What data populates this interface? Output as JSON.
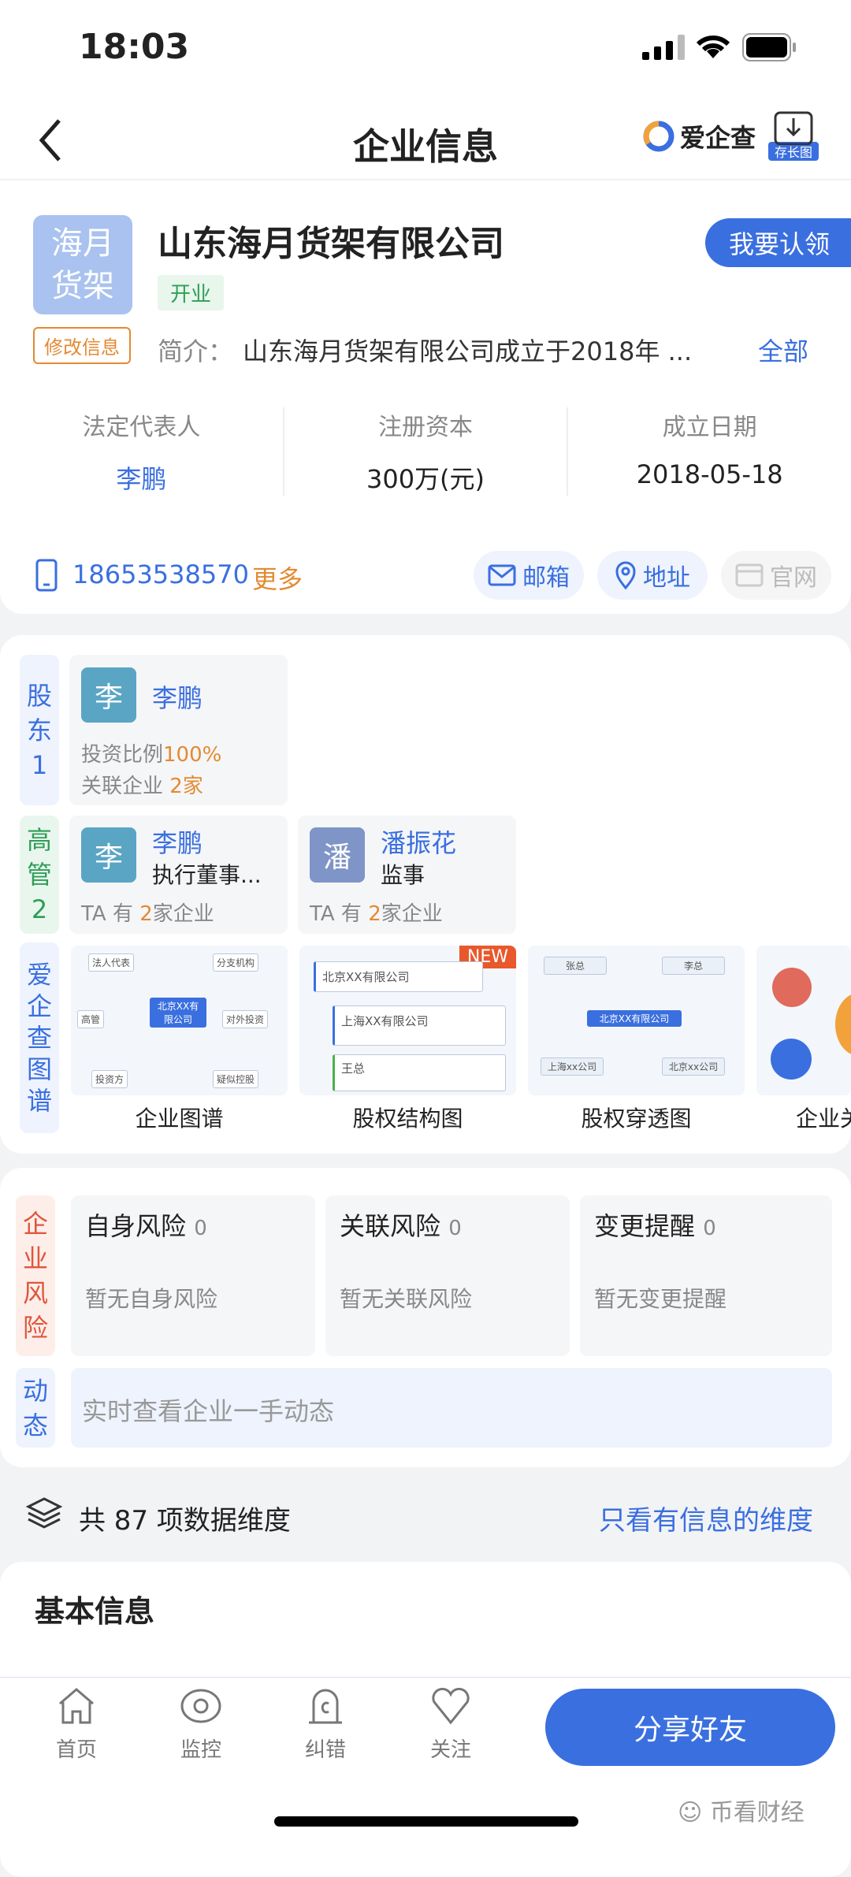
{
  "status": {
    "time": "18:03"
  },
  "nav": {
    "title": "企业信息",
    "brand": "爱企查",
    "save_long": "存长图"
  },
  "company": {
    "logo_text": [
      "海月",
      "货架"
    ],
    "name": "山东海月货架有限公司",
    "status": "开业",
    "edit": "修改信息",
    "claim": "我要认领",
    "intro_label": "简介：",
    "intro": "山东海月货架有限公司成立于2018年 ...",
    "intro_all": "全部",
    "stats": [
      {
        "label": "法定代表人",
        "value": "李鹏"
      },
      {
        "label": "注册资本",
        "value": "300万(元)"
      },
      {
        "label": "成立日期",
        "value": "2018-05-18"
      }
    ],
    "phone": "18653538570",
    "more": "更多",
    "email": "邮箱",
    "address": "地址",
    "website": "官网"
  },
  "shareholders": {
    "label": [
      "股",
      "东",
      "1"
    ],
    "items": [
      {
        "avatar": "李",
        "name": "李鹏",
        "ratio_label": "投资比例",
        "ratio": "100%",
        "related_label": "关联企业",
        "related": "2家"
      }
    ]
  },
  "executives": {
    "label": [
      "高",
      "管",
      "2"
    ],
    "items": [
      {
        "avatar": "李",
        "name": "李鹏",
        "role": "执行董事...",
        "ta": "TA 有",
        "count": "2",
        "suffix": "家企业"
      },
      {
        "avatar": "潘",
        "name": "潘振花",
        "role": "监事",
        "ta": "TA 有",
        "count": "2",
        "suffix": "家企业"
      }
    ]
  },
  "graphs": {
    "label": [
      "爱",
      "企",
      "查",
      "图",
      "谱"
    ],
    "new_badge": "NEW",
    "items": [
      "企业图谱",
      "股权结构图",
      "股权穿透图",
      "企业关"
    ],
    "g1": [
      "法人代表",
      "分支机构",
      "高管",
      "对外投资",
      "投资方",
      "疑似控股",
      "北京XX有限公司"
    ],
    "g2": [
      "北京XX有限公司",
      "上海XX有限公司",
      "王总"
    ],
    "g3": [
      "张总",
      "李总",
      "北京XX有限公司",
      "上海xx公司",
      "北京xx公司"
    ]
  },
  "risk": {
    "label": [
      "企",
      "业",
      "风",
      "险"
    ],
    "items": [
      {
        "title": "自身风险",
        "count": "0",
        "desc": "暂无自身风险"
      },
      {
        "title": "关联风险",
        "count": "0",
        "desc": "暂无关联风险"
      },
      {
        "title": "变更提醒",
        "count": "0",
        "desc": "暂无变更提醒"
      }
    ]
  },
  "dynamics": {
    "label": [
      "动",
      "态"
    ],
    "text": "实时查看企业一手动态"
  },
  "dimensions": {
    "text": "共 87 项数据维度",
    "filter": "只看有信息的维度"
  },
  "basic": {
    "title": "基本信息"
  },
  "bottom": {
    "items": [
      "首页",
      "监控",
      "纠错",
      "关注"
    ],
    "share": "分享好友"
  },
  "watermark": "币看财经"
}
